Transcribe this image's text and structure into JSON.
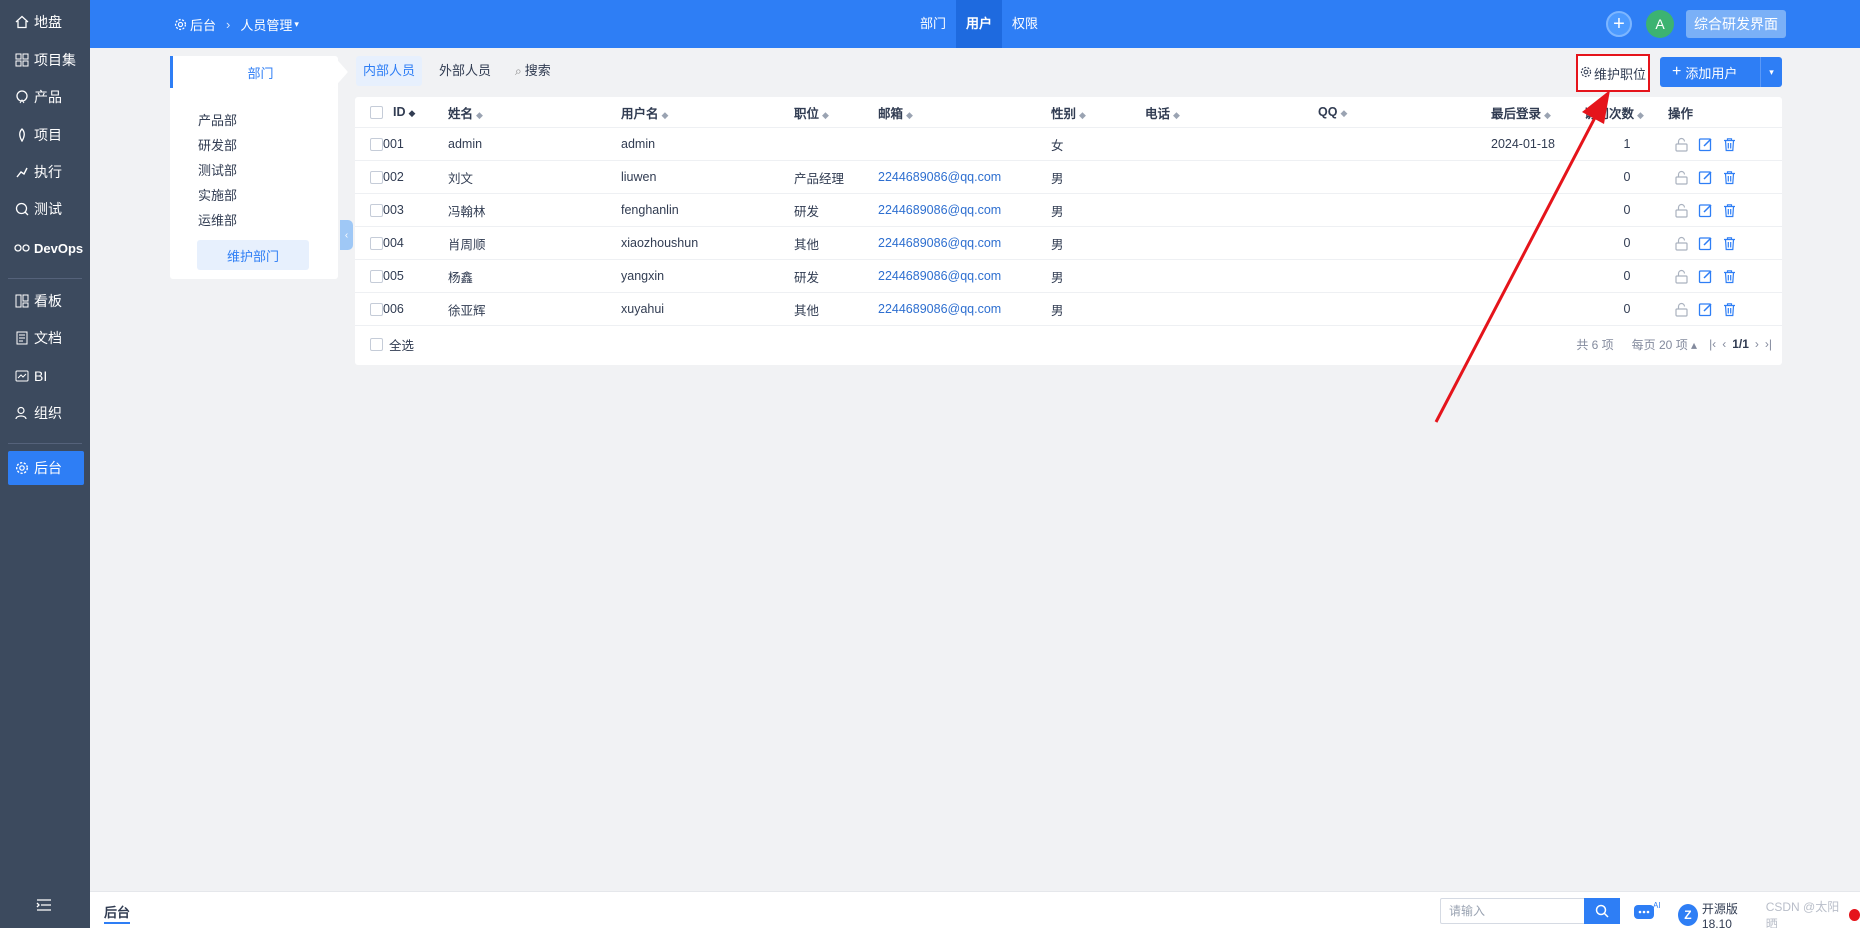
{
  "sidebar": {
    "items": [
      {
        "label": "地盘",
        "icon": "home-icon"
      },
      {
        "label": "项目集",
        "icon": "grid-icon"
      },
      {
        "label": "产品",
        "icon": "product-icon"
      },
      {
        "label": "项目",
        "icon": "project-icon"
      },
      {
        "label": "执行",
        "icon": "run-icon"
      },
      {
        "label": "测试",
        "icon": "test-icon"
      },
      {
        "label": "DevOps",
        "icon": "devops-icon"
      },
      {
        "label": "看板",
        "icon": "kanban-icon"
      },
      {
        "label": "文档",
        "icon": "doc-icon"
      },
      {
        "label": "BI",
        "icon": "bi-icon"
      },
      {
        "label": "组织",
        "icon": "org-icon"
      },
      {
        "label": "后台",
        "icon": "gear-icon"
      }
    ],
    "active_index": 11
  },
  "header": {
    "breadcrumb_root": "后台",
    "breadcrumb_current": "人员管理",
    "nav": [
      "部门",
      "用户",
      "权限"
    ],
    "active_nav": 1,
    "avatar_letter": "A",
    "brand_button": "综合研发界面"
  },
  "dept": {
    "title": "部门",
    "items": [
      "产品部",
      "研发部",
      "测试部",
      "实施部",
      "运维部"
    ],
    "manage_button": "维护部门"
  },
  "tabs": {
    "internal": "内部人员",
    "external": "外部人员",
    "search": "搜索"
  },
  "toolbar": {
    "maintain_position": "维护职位",
    "add_user": "添加用户"
  },
  "table": {
    "columns": [
      "ID",
      "姓名",
      "用户名",
      "职位",
      "邮箱",
      "性别",
      "电话",
      "QQ",
      "最后登录",
      "访问次数",
      "操作"
    ],
    "rows": [
      {
        "id": "001",
        "name": "admin",
        "username": "admin",
        "position": "",
        "email": "",
        "gender": "女",
        "phone": "",
        "qq": "",
        "last_login": "2024-01-18",
        "visits": "1"
      },
      {
        "id": "002",
        "name": "刘文",
        "username": "liuwen",
        "position": "产品经理",
        "email": "2244689086@qq.com",
        "gender": "男",
        "phone": "",
        "qq": "",
        "last_login": "",
        "visits": "0"
      },
      {
        "id": "003",
        "name": "冯翰林",
        "username": "fenghanlin",
        "position": "研发",
        "email": "2244689086@qq.com",
        "gender": "男",
        "phone": "",
        "qq": "",
        "last_login": "",
        "visits": "0"
      },
      {
        "id": "004",
        "name": "肖周顺",
        "username": "xiaozhoushun",
        "position": "其他",
        "email": "2244689086@qq.com",
        "gender": "男",
        "phone": "",
        "qq": "",
        "last_login": "",
        "visits": "0"
      },
      {
        "id": "005",
        "name": "杨鑫",
        "username": "yangxin",
        "position": "研发",
        "email": "2244689086@qq.com",
        "gender": "男",
        "phone": "",
        "qq": "",
        "last_login": "",
        "visits": "0"
      },
      {
        "id": "006",
        "name": "徐亚辉",
        "username": "xuyahui",
        "position": "其他",
        "email": "2244689086@qq.com",
        "gender": "男",
        "phone": "",
        "qq": "",
        "last_login": "",
        "visits": "0"
      }
    ],
    "select_all": "全选",
    "total": "共 6 项",
    "per_page": "每页 20 项",
    "page": "1/1"
  },
  "bottombar": {
    "title": "后台",
    "search_placeholder": "请输入",
    "version": "开源版18.10",
    "watermark": "CSDN @太阳晒"
  },
  "colors": {
    "primary": "#2e7ef5",
    "sidebar": "#3c4a5e",
    "highlight_box": "#e5141b",
    "arrow": "#e5141b"
  }
}
